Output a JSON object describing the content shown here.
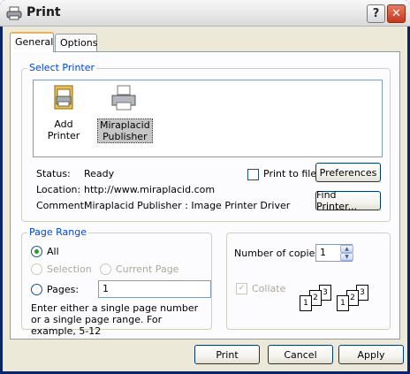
{
  "window": {
    "title": "Print",
    "help_label": "?",
    "close_label": "✕"
  },
  "tabs": [
    {
      "label": "General"
    },
    {
      "label": "Options"
    }
  ],
  "select_printer": {
    "legend": "Select Printer",
    "printers": [
      {
        "label": "Add Printer",
        "icon": "add-printer-icon"
      },
      {
        "label": "Miraplacid Publisher",
        "icon": "printer-icon",
        "selected": true
      }
    ],
    "status_key": "Status:",
    "status_value": "Ready",
    "location_key": "Location:",
    "location_value": "http://www.miraplacid.com",
    "comment_key": "Comment:",
    "comment_value": "Miraplacid Publisher : Image Printer Driver",
    "print_to_file_label": "Print to file",
    "print_to_file_checked": false,
    "preferences_label": "Preferences",
    "find_printer_label": "Find Printer..."
  },
  "page_range": {
    "legend": "Page Range",
    "all_label": "All",
    "selection_label": "Selection",
    "current_page_label": "Current Page",
    "pages_label": "Pages:",
    "pages_value": "1",
    "hint": "Enter either a single page number or a single page range.  For example, 5-12"
  },
  "copies": {
    "label": "Number of copies:",
    "value": "1",
    "collate_label": "Collate",
    "collate_checked": true
  },
  "footer": {
    "print_label": "Print",
    "cancel_label": "Cancel",
    "apply_label": "Apply"
  },
  "colors": {
    "accent": "#0046d5",
    "title_bg": "#ececec",
    "dialog_bg": "#ece9d8"
  }
}
